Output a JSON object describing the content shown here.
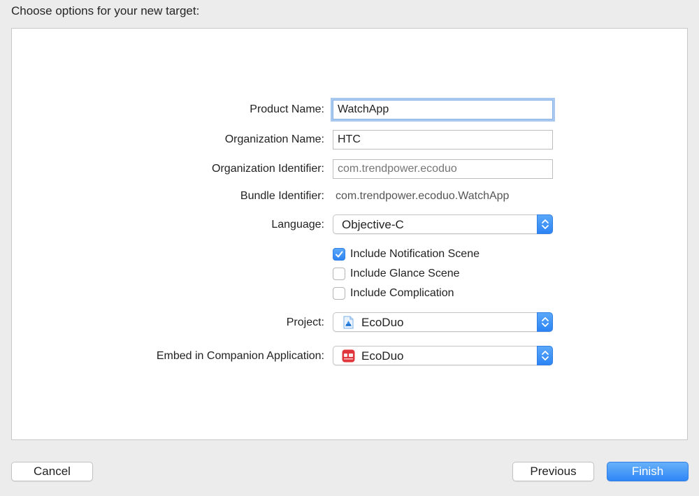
{
  "header": {
    "title": "Choose options for your new target:"
  },
  "form": {
    "product_name": {
      "label": "Product Name:",
      "value": "WatchApp"
    },
    "organization_name": {
      "label": "Organization Name:",
      "value": "HTC"
    },
    "organization_identifier": {
      "label": "Organization Identifier:",
      "placeholder": "com.trendpower.ecoduo"
    },
    "bundle_identifier": {
      "label": "Bundle Identifier:",
      "value": "com.trendpower.ecoduo.WatchApp"
    },
    "language": {
      "label": "Language:",
      "selected": "Objective-C"
    },
    "checkboxes": [
      {
        "label": "Include Notification Scene",
        "checked": true
      },
      {
        "label": "Include Glance Scene",
        "checked": false
      },
      {
        "label": "Include Complication",
        "checked": false
      }
    ],
    "project": {
      "label": "Project:",
      "selected": "EcoDuo",
      "icon": "xcode-project-icon"
    },
    "companion_app": {
      "label": "Embed in Companion Application:",
      "selected": "EcoDuo",
      "icon": "app-icon"
    }
  },
  "footer": {
    "cancel_label": "Cancel",
    "previous_label": "Previous",
    "finish_label": "Finish"
  },
  "colors": {
    "accent": "#2d84f4",
    "window_bg": "#ececec",
    "panel_bg": "#ffffff",
    "app_icon": "#e0353d"
  }
}
